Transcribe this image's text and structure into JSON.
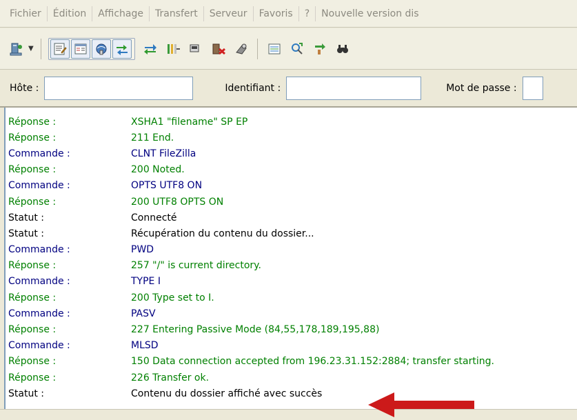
{
  "menu": [
    "Fichier",
    "Édition",
    "Affichage",
    "Transfert",
    "Serveur",
    "Favoris",
    "?",
    "Nouvelle version dis"
  ],
  "quickconnect": {
    "host_label": "Hôte :",
    "host_value": "",
    "user_label": "Identifiant :",
    "user_value": "",
    "pass_label": "Mot de passe :",
    "pass_value": ""
  },
  "log": [
    {
      "type": "reponse",
      "label": "Réponse :",
      "message": "XSHA1 \"filename\" SP EP"
    },
    {
      "type": "reponse",
      "label": "Réponse :",
      "message": "211 End."
    },
    {
      "type": "commande",
      "label": "Commande :",
      "message": "CLNT FileZilla"
    },
    {
      "type": "reponse",
      "label": "Réponse :",
      "message": "200 Noted."
    },
    {
      "type": "commande",
      "label": "Commande :",
      "message": "OPTS UTF8 ON"
    },
    {
      "type": "reponse",
      "label": "Réponse :",
      "message": "200 UTF8 OPTS ON"
    },
    {
      "type": "statut",
      "label": "Statut :",
      "message": "Connecté"
    },
    {
      "type": "statut",
      "label": "Statut :",
      "message": "Récupération du contenu du dossier..."
    },
    {
      "type": "commande",
      "label": "Commande :",
      "message": "PWD"
    },
    {
      "type": "reponse",
      "label": "Réponse :",
      "message": "257 \"/\" is current directory."
    },
    {
      "type": "commande",
      "label": "Commande :",
      "message": "TYPE I"
    },
    {
      "type": "reponse",
      "label": "Réponse :",
      "message": "200 Type set to I."
    },
    {
      "type": "commande",
      "label": "Commande :",
      "message": "PASV"
    },
    {
      "type": "reponse",
      "label": "Réponse :",
      "message": "227 Entering Passive Mode (84,55,178,189,195,88)"
    },
    {
      "type": "commande",
      "label": "Commande :",
      "message": "MLSD"
    },
    {
      "type": "reponse",
      "label": "Réponse :",
      "message": "150 Data connection accepted from 196.23.31.152:2884; transfer starting."
    },
    {
      "type": "reponse",
      "label": "Réponse :",
      "message": "226 Transfer ok."
    },
    {
      "type": "statut",
      "label": "Statut :",
      "message": "Contenu du dossier affiché avec succès"
    }
  ],
  "colors": {
    "reponse": "#008000",
    "commande": "#000080",
    "statut": "#000000",
    "annotation_arrow": "#cc1a1a"
  },
  "toolbar_icons": [
    "site-manager-icon",
    "toggle-log-icon",
    "toggle-local-tree-icon",
    "toggle-remote-tree-icon",
    "toggle-queue-icon",
    "refresh-icon",
    "process-queue-icon",
    "cancel-icon",
    "disconnect-icon",
    "reconnect-icon",
    "directory-listing-filters-icon",
    "compare-directories-icon",
    "synchronized-browsing-icon",
    "search-icon"
  ]
}
